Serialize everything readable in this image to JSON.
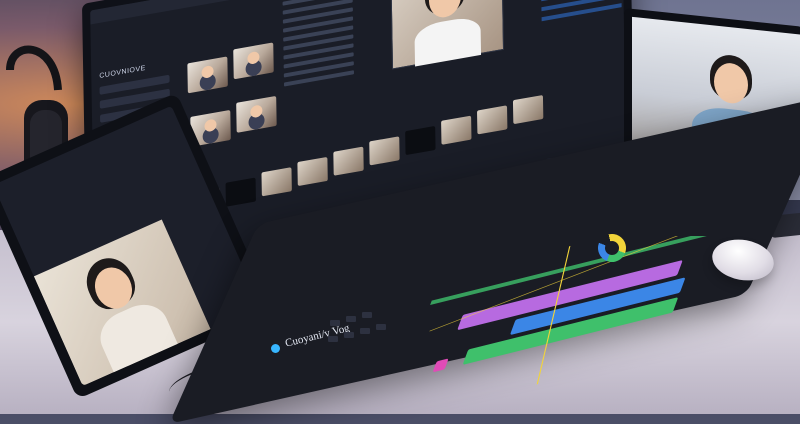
{
  "scene": {
    "description_colors": {
      "accent_blue": "#2f6fd0",
      "track_green": "#3fc06b",
      "track_purple": "#b76ae0",
      "track_yellow": "#f2d43a",
      "track_pink": "#e04bb7"
    }
  },
  "main_monitor": {
    "app_logo": "CUOVNIOVE"
  },
  "control_panel": {
    "label": "Cuoyani/v Vog"
  }
}
